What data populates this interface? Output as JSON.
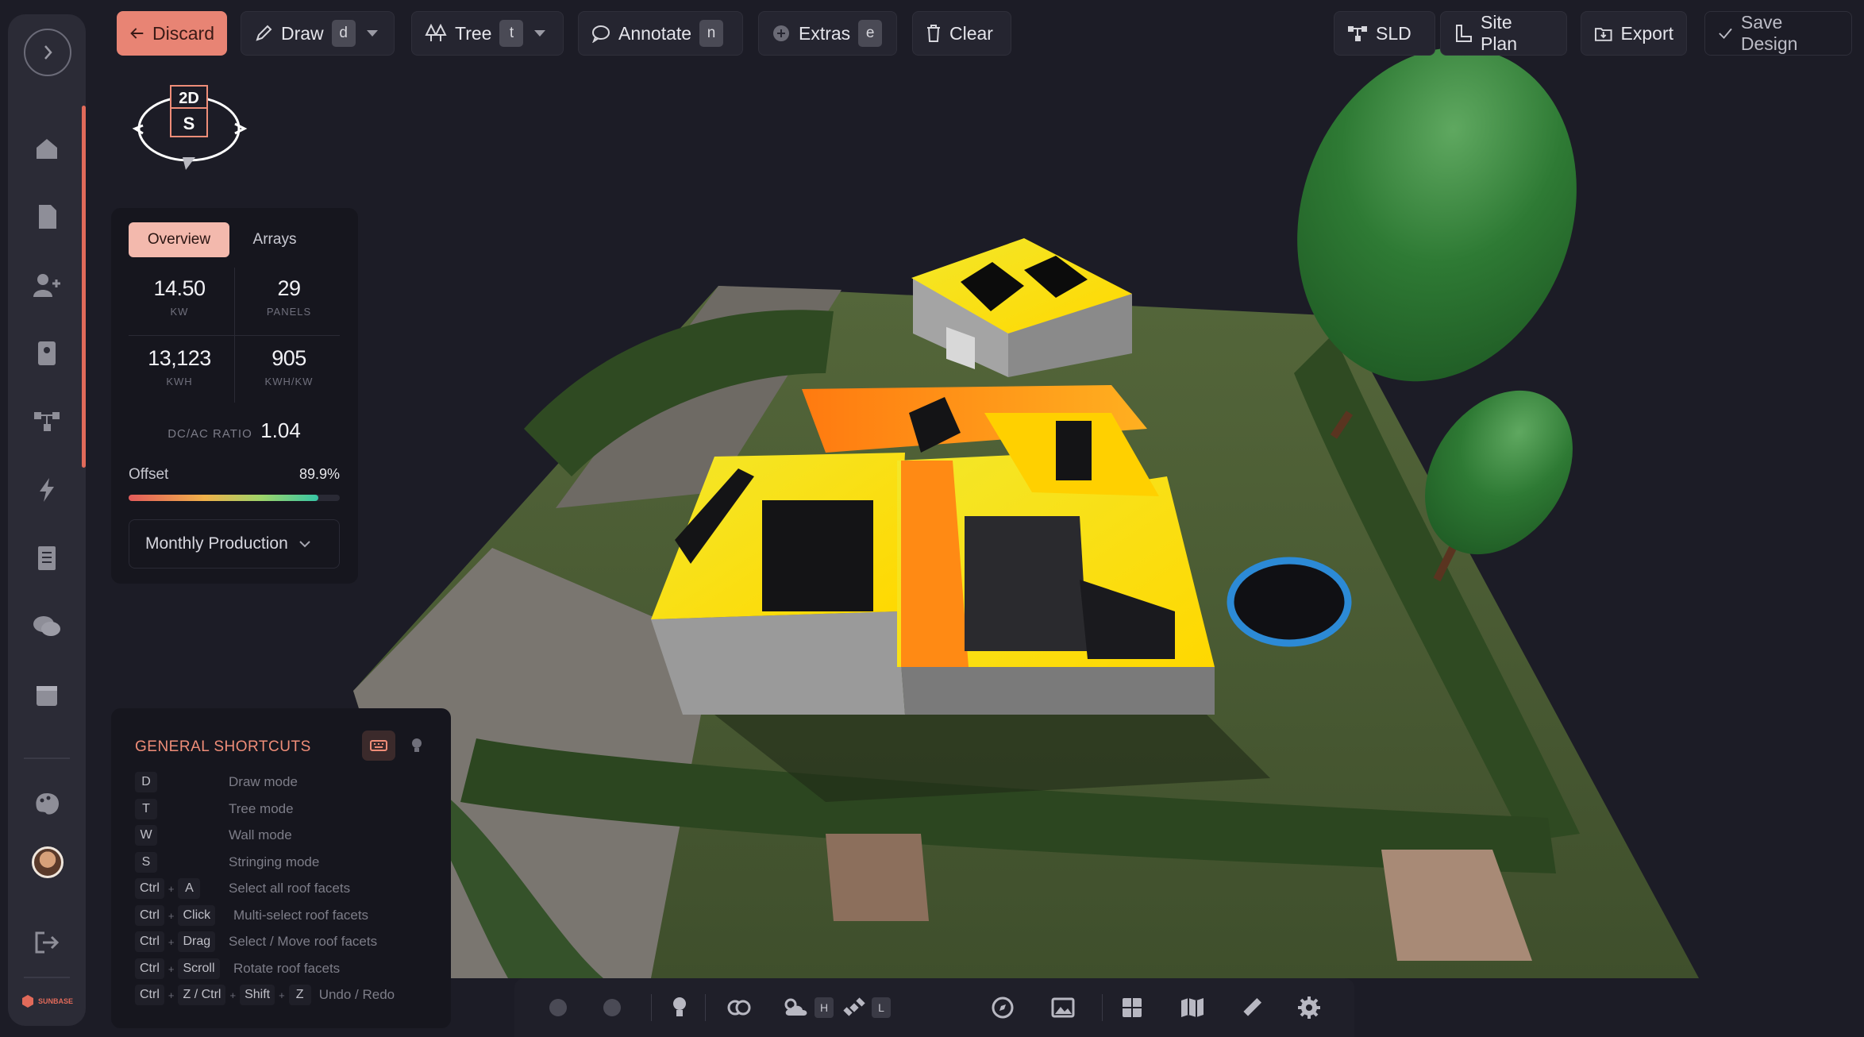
{
  "toolbar": {
    "discard": "Discard",
    "draw": {
      "label": "Draw",
      "key": "d"
    },
    "tree": {
      "label": "Tree",
      "key": "t"
    },
    "annotate": {
      "label": "Annotate",
      "key": "n"
    },
    "extras": {
      "label": "Extras",
      "key": "e"
    },
    "clear": "Clear",
    "sld": "SLD",
    "site_plan": "Site Plan",
    "export": "Export",
    "save_design": "Save Design"
  },
  "compass": {
    "top": "2D",
    "face": "S"
  },
  "overview": {
    "tabs": [
      "Overview",
      "Arrays"
    ],
    "stats": [
      {
        "value": "14.50",
        "unit": "KW"
      },
      {
        "value": "29",
        "unit": "PANELS"
      },
      {
        "value": "13,123",
        "unit": "KWH"
      },
      {
        "value": "905",
        "unit": "KWH/KW"
      }
    ],
    "dc_ac_label": "DC/AC RATIO",
    "dc_ac_value": "1.04",
    "offset_label": "Offset",
    "offset_value": "89.9%",
    "offset_fraction": 0.899,
    "monthly_production": "Monthly Production"
  },
  "shortcuts": {
    "title": "GENERAL SHORTCUTS",
    "rows": [
      {
        "keys": [
          "D"
        ],
        "desc": "Draw mode"
      },
      {
        "keys": [
          "T"
        ],
        "desc": "Tree mode"
      },
      {
        "keys": [
          "W"
        ],
        "desc": "Wall mode"
      },
      {
        "keys": [
          "S"
        ],
        "desc": "Stringing mode"
      },
      {
        "keys": [
          "Ctrl",
          "A"
        ],
        "desc": "Select all roof facets"
      },
      {
        "keys": [
          "Ctrl",
          "Click"
        ],
        "desc": "Multi-select roof facets"
      },
      {
        "keys": [
          "Ctrl",
          "Drag"
        ],
        "desc": "Select / Move roof facets"
      },
      {
        "keys": [
          "Ctrl",
          "Scroll"
        ],
        "desc": "Rotate roof facets"
      },
      {
        "keys": [
          "Ctrl",
          "Z / Ctrl",
          "Shift",
          "Z"
        ],
        "desc": "Undo / Redo"
      }
    ]
  },
  "bottombar": {
    "keys": {
      "shade": "H",
      "lidar": "L"
    }
  },
  "brand": "SUNBASE",
  "colors": {
    "accent": "#e16a5a",
    "panel": "#16161e",
    "background": "#1c1c26"
  }
}
